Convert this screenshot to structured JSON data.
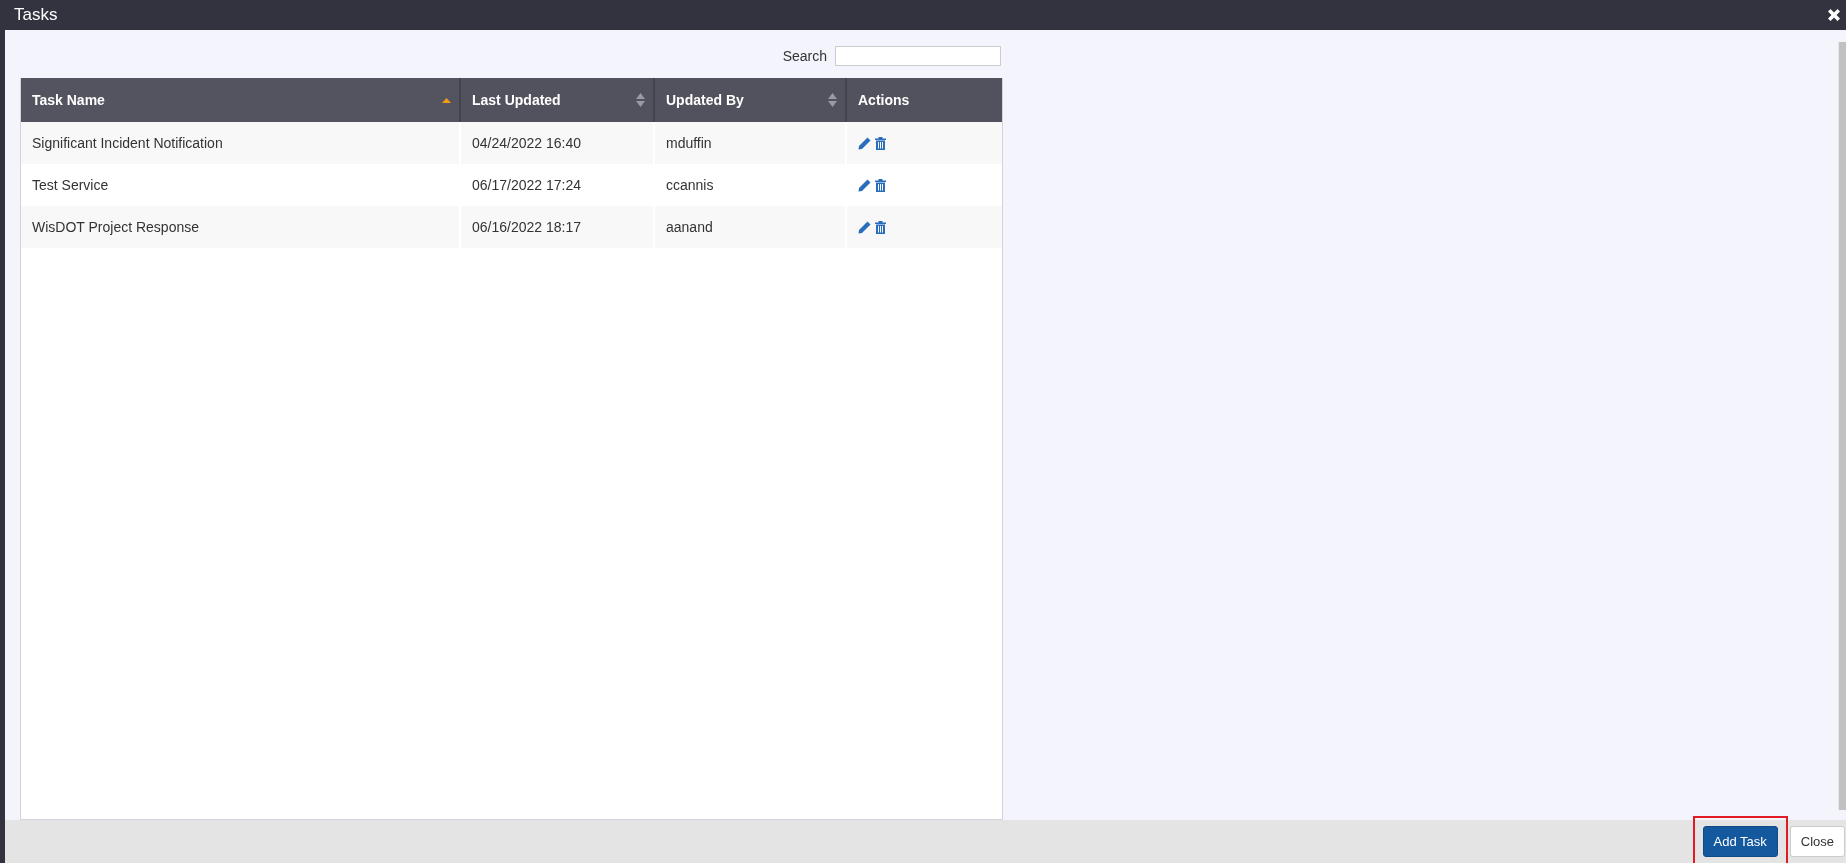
{
  "window": {
    "title": "Tasks"
  },
  "search": {
    "label": "Search"
  },
  "table": {
    "columns": [
      {
        "label": "Task Name",
        "sortable": true,
        "sorted": true
      },
      {
        "label": "Last Updated",
        "sortable": true,
        "sorted": false
      },
      {
        "label": "Updated By",
        "sortable": true,
        "sorted": false
      },
      {
        "label": "Actions",
        "sortable": false
      }
    ],
    "rows": [
      {
        "task_name": "Significant Incident Notification",
        "last_updated": "04/24/2022 16:40",
        "updated_by": "mduffin"
      },
      {
        "task_name": "Test Service",
        "last_updated": "06/17/2022 17:24",
        "updated_by": "ccannis"
      },
      {
        "task_name": "WisDOT Project Response",
        "last_updated": "06/16/2022 18:17",
        "updated_by": "aanand"
      }
    ]
  },
  "buttons": [
    {
      "label": "Add Task",
      "kind": "primary",
      "highlighted": true
    },
    {
      "label": "Close",
      "kind": "default",
      "highlighted": false
    }
  ]
}
